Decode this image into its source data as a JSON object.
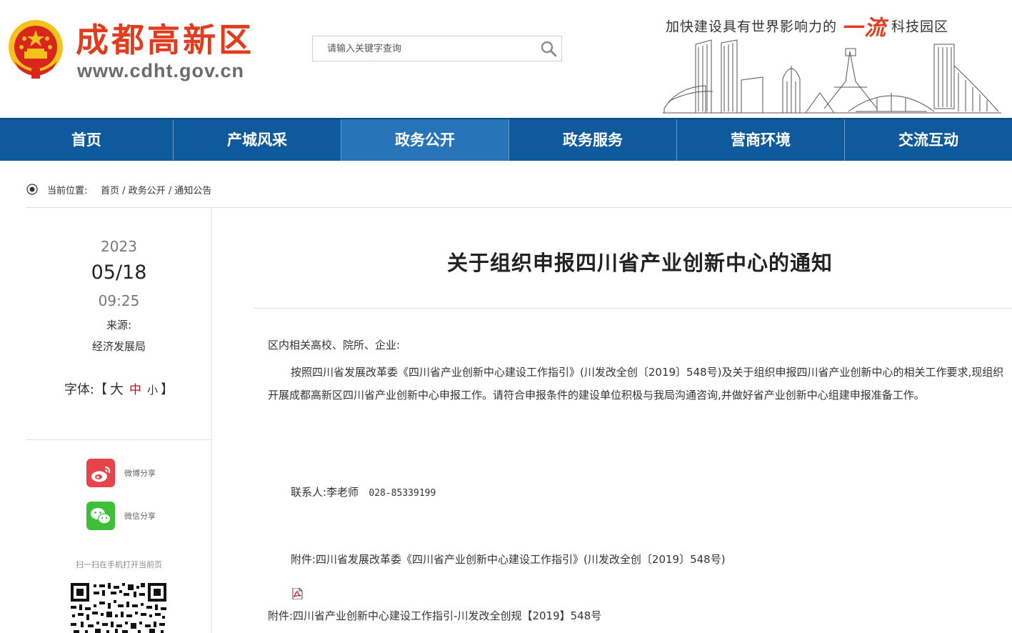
{
  "header": {
    "site_name": "成都高新区",
    "site_url": "www.cdht.gov.cn",
    "search_placeholder": "请输入关键字查询",
    "slogan_part1": "加快建设具有世界影响力的",
    "slogan_part2": "一流",
    "slogan_part3": "科技园区",
    "brand_color": "#e23c1f"
  },
  "nav": {
    "color": "#0e5a9c",
    "active_color": "#2774b9",
    "items": [
      {
        "label": "首页"
      },
      {
        "label": "产城风采"
      },
      {
        "label": "政务公开"
      },
      {
        "label": "政务服务"
      },
      {
        "label": "营商环境"
      },
      {
        "label": "交流互动"
      }
    ],
    "active_index": 2
  },
  "breadcrumb": {
    "label": "当前位置:",
    "items": [
      "首页",
      "政务公开",
      "通知公告"
    ],
    "separator": " / "
  },
  "article_meta": {
    "year": "2023",
    "day": "05/18",
    "time": "09:25",
    "source_label": "来源:",
    "source": "经济发展局",
    "font_size_label": "字体:",
    "bracket_open": "【",
    "bracket_close": "】",
    "font_large": "大",
    "font_medium": "中",
    "font_small": "小"
  },
  "share": {
    "weibo_label": "微博分享",
    "wechat_label": "微信分享",
    "scan_text": "扫一扫在手机打开当前页"
  },
  "article": {
    "title": "关于组织申报四川省产业创新中心的通知",
    "salutation": "区内相关高校、院所、企业:",
    "paragraph1": "按照四川省发展改革委《四川省产业创新中心建设工作指引》(川发改全创〔2019〕548号)及关于组织申报四川省产业创新中心的相关工作要求,现组织开展成都高新区四川省产业创新中心申报工作。请符合申报条件的建设单位积极与我局沟通咨询,并做好省产业创新中心组建申报准备工作。",
    "contact_label": "联系人:李老师",
    "contact_phone": "028-85339199",
    "attachment_note": "附件:四川省发展改革委《四川省产业创新中心建设工作指引》(川发改全创〔2019〕548号)",
    "attachment_file": "附件:四川省产业创新中心建设工作指引-川发改全创规【2019】548号"
  }
}
